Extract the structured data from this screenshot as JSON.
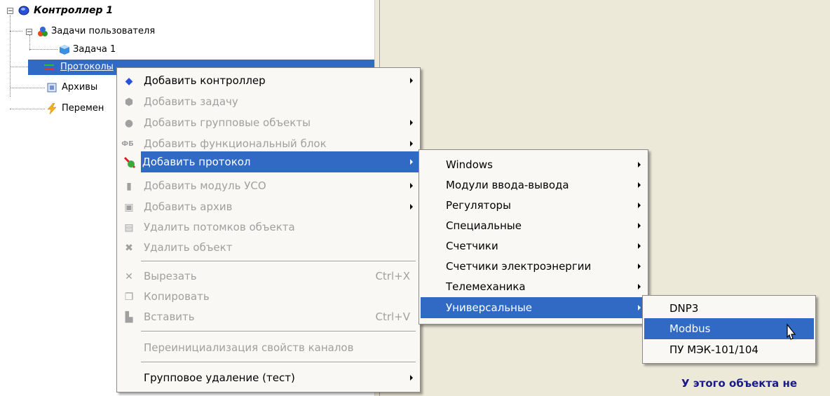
{
  "tree": {
    "root": {
      "label": "Контроллер 1",
      "icon": "controller-icon"
    },
    "user_tasks": {
      "label": "Задачи пользователя",
      "icon": "tasks-icon"
    },
    "task1": {
      "label": "Задача 1",
      "icon": "task-cube-icon"
    },
    "protocols": {
      "label": "Протоколы",
      "icon": "protocol-icon"
    },
    "archives": {
      "label": "Архивы",
      "icon": "archive-icon"
    },
    "variables": {
      "label": "Перемен",
      "icon": "lightning-icon"
    }
  },
  "right_pane": {
    "message": "У этого объекта не"
  },
  "context_menu": {
    "items": [
      {
        "label": "Добавить контроллер",
        "icon": "controller-icon",
        "enabled": true,
        "submenu": true
      },
      {
        "label": "Добавить задачу",
        "icon": "task-icon",
        "enabled": false,
        "submenu": false
      },
      {
        "label": "Добавить групповые объекты",
        "icon": "group-icon",
        "enabled": false,
        "submenu": true
      },
      {
        "label": "Добавить функциональный блок",
        "icon_text": "ФБ",
        "enabled": false,
        "submenu": true
      },
      {
        "label": "Добавить протокол",
        "icon": "protocol-add-icon",
        "enabled": true,
        "submenu": true,
        "highlighted": true
      },
      {
        "label": "Добавить модуль УСО",
        "icon": "module-icon",
        "enabled": false,
        "submenu": true
      },
      {
        "label": "Добавить архив",
        "icon": "archive-icon",
        "enabled": false,
        "submenu": true
      },
      {
        "label": "Удалить потомков объекта",
        "icon": "delete-children-icon",
        "enabled": false,
        "submenu": false
      },
      {
        "label": "Удалить объект",
        "icon": "delete-icon",
        "enabled": false,
        "submenu": false
      },
      {
        "label": "Вырезать",
        "icon": "cut-icon",
        "shortcut": "Ctrl+X",
        "enabled": false
      },
      {
        "label": "Копировать",
        "icon": "copy-icon",
        "enabled": false
      },
      {
        "label": "Вставить",
        "icon": "paste-icon",
        "shortcut": "Ctrl+V",
        "enabled": false
      },
      {
        "label": "Переинициализация свойств каналов",
        "enabled": false
      },
      {
        "label": "Групповое удаление (тест)",
        "enabled": true,
        "submenu": true
      }
    ]
  },
  "protocol_menu": {
    "items": [
      {
        "label": "Windows"
      },
      {
        "label": "Модули ввода-вывода"
      },
      {
        "label": "Регуляторы"
      },
      {
        "label": "Специальные"
      },
      {
        "label": "Счетчики"
      },
      {
        "label": "Счетчики электроэнергии"
      },
      {
        "label": "Телемеханика"
      },
      {
        "label": "Универсальные",
        "highlighted": true
      }
    ]
  },
  "universal_menu": {
    "items": [
      {
        "label": "DNP3"
      },
      {
        "label": "Modbus",
        "highlighted": true
      },
      {
        "label": "ПУ МЭК-101/104"
      }
    ]
  },
  "colors": {
    "highlight": "#316ac5",
    "disabled_text": "#a0a0a0",
    "pane_background": "#ece9d8"
  }
}
